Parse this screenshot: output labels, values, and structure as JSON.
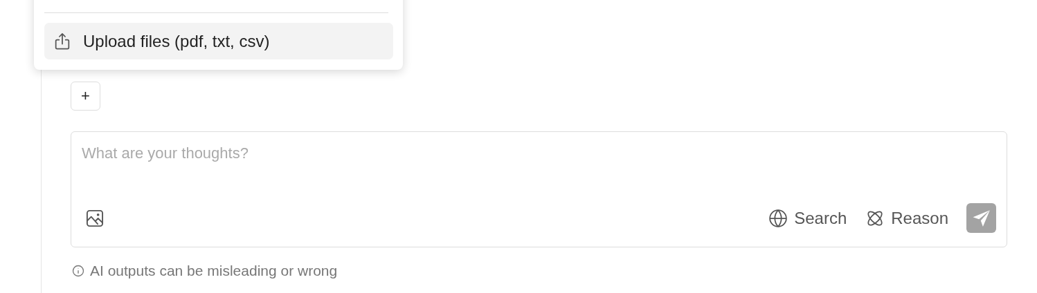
{
  "add_button": {
    "label": "+"
  },
  "attach_menu": {
    "items": [
      {
        "label": "Upload files (pdf, txt, csv)",
        "selected": true
      }
    ]
  },
  "composer": {
    "placeholder": "What are your thoughts?",
    "toggles": [
      {
        "kind": "search",
        "label": "Search",
        "on": false
      },
      {
        "kind": "reason",
        "label": "Reason",
        "on": false
      }
    ],
    "send_disabled": true
  },
  "disclaimer": "AI outputs can be misleading or wrong"
}
